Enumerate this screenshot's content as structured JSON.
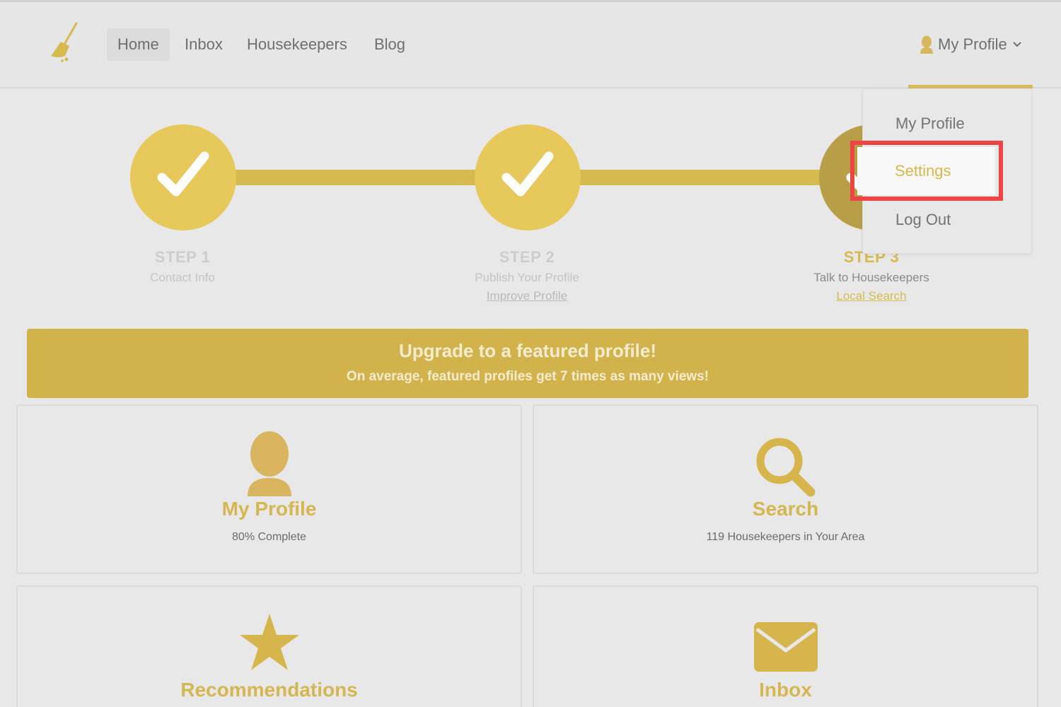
{
  "nav": {
    "items": [
      {
        "label": "Home",
        "active": true
      },
      {
        "label": "Inbox",
        "active": false
      },
      {
        "label": "Housekeepers",
        "active": false
      },
      {
        "label": "Blog",
        "active": false
      }
    ],
    "profile_label": "My Profile",
    "logo_icon": "broom-icon"
  },
  "dropdown": {
    "items": [
      {
        "label": "My Profile"
      },
      {
        "label": "Settings",
        "highlighted": true
      },
      {
        "label": "Log Out"
      }
    ]
  },
  "steps": [
    {
      "title": "STEP 1",
      "subtitle": "Contact Info",
      "link": ""
    },
    {
      "title": "STEP 2",
      "subtitle": "Publish Your Profile",
      "link": "Improve Profile"
    },
    {
      "title": "STEP 3",
      "subtitle": "Talk to Housekeepers",
      "link": "Local Search"
    }
  ],
  "banner": {
    "title": "Upgrade to a featured profile!",
    "subtitle": "On average, featured profiles get 7 times as many views!"
  },
  "cards": [
    {
      "title": "My Profile",
      "subtitle": "80% Complete",
      "icon": "person-icon"
    },
    {
      "title": "Search",
      "subtitle": "119 Housekeepers in Your Area",
      "icon": "magnifier-icon"
    },
    {
      "title": "Recommendations",
      "subtitle": "",
      "icon": "star-icon"
    },
    {
      "title": "Inbox",
      "subtitle": "",
      "icon": "envelope-icon"
    }
  ],
  "colors": {
    "accent": "#d6b94f",
    "highlight": "#ef4444",
    "background": "#e8e8e8"
  }
}
